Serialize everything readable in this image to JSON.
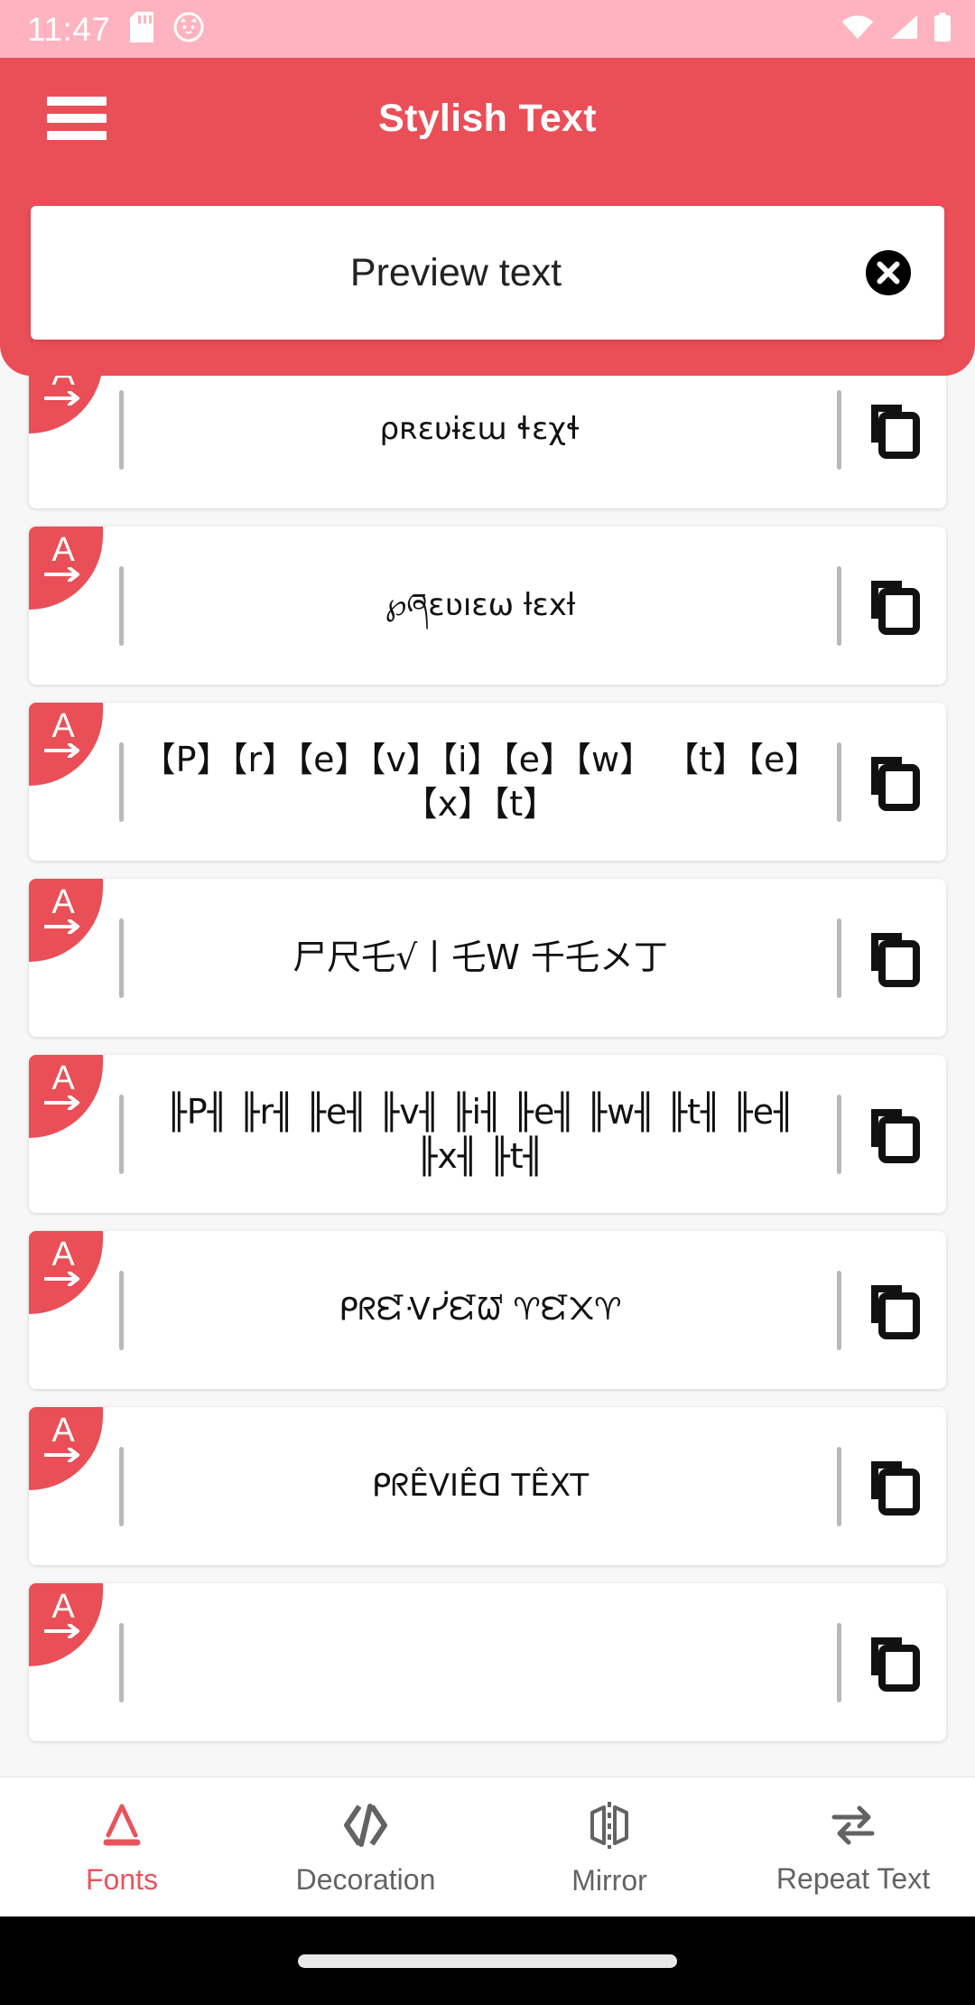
{
  "status_bar": {
    "time": "11:47",
    "icons_left": [
      "sd-card-icon",
      "cat-face-icon"
    ],
    "icons_right": [
      "wifi-icon",
      "cellular-signal-icon",
      "battery-icon"
    ],
    "background_color": "#ffb3c0"
  },
  "app_bar": {
    "menu_icon": "hamburger-menu-icon",
    "title": "Stylish Text",
    "background_color": "#ea4e57"
  },
  "search": {
    "value": "Preview text",
    "placeholder": "Preview text",
    "clear_icon": "clear-circle-x-icon"
  },
  "font_list": {
    "badge_letter": "A",
    "badge_icon": "a-arrow-font-icon",
    "copy_icon": "copy-icon",
    "items": [
      {
        "text": "ρʀɛυɨɛա ɬɛχɬ",
        "size": "normal"
      },
      {
        "text": "℘ཞɛʋıɛω ƚɛxƚ",
        "size": "normal"
      },
      {
        "text": "【P】【r】【e】【v】【i】【e】【w】 【t】【e】【x】【t】",
        "size": "big"
      },
      {
        "text": "尸尺乇√丨乇W 千乇メ丁",
        "size": "big"
      },
      {
        "text": "╟P╢ ╟r╢ ╟e╢ ╟v╢ ╟i╢ ╟e╢ ╟w╢ ╟t╢ ╟e╢ ╟x╢ ╟t╢",
        "size": "big"
      },
      {
        "text": "ᑭᖇᘿᐺᓰᘿᘺ ♈ᘿ᙭♈",
        "size": "normal"
      },
      {
        "text": "ᑭᖇÊVIÊᗡ TÊXT",
        "size": "normal"
      },
      {
        "text": "",
        "size": "normal"
      }
    ]
  },
  "bottom_nav": {
    "items": [
      {
        "label": "Fonts",
        "icon": "font-a-icon",
        "active": true
      },
      {
        "label": "Decoration",
        "icon": "decoration-ribbon-icon",
        "active": false
      },
      {
        "label": "Mirror",
        "icon": "mirror-flip-icon",
        "active": false
      },
      {
        "label": "Repeat Text",
        "icon": "repeat-arrows-icon",
        "active": false
      }
    ],
    "active_color": "#e8545c",
    "inactive_color": "#636363"
  },
  "gesture_bar": {
    "pill": "home-gesture-pill"
  }
}
